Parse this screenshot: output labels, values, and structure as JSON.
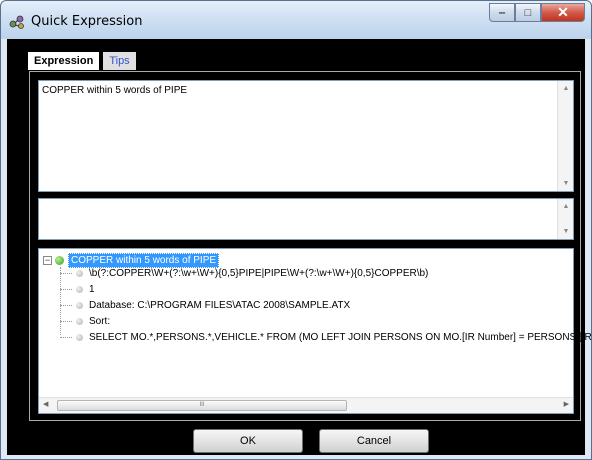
{
  "window": {
    "title": "Quick Expression",
    "minimize_glyph": "‒",
    "maximize_glyph": "□",
    "close_glyph": "✕"
  },
  "tabs": [
    {
      "label": "Expression",
      "active": true
    },
    {
      "label": "Tips",
      "active": false
    }
  ],
  "expression_text": "COPPER within 5 words of PIPE",
  "secondary_text": "",
  "tree": {
    "root": "COPPER within 5 words of PIPE",
    "children": [
      "\\b(?:COPPER\\W+(?:\\w+\\W+){0,5}PIPE|PIPE\\W+(?:\\w+\\W+){0,5}COPPER\\b)",
      "1",
      "Database: C:\\PROGRAM FILES\\ATAC 2008\\SAMPLE.ATX",
      "Sort:",
      "SELECT MO.*,PERSONS.*,VEHICLE.* FROM (MO LEFT JOIN PERSONS ON MO.[IR Number] = PERSONS.[IR N"
    ],
    "scroll_grip": "III"
  },
  "buttons": {
    "ok_label": "OK",
    "cancel_label": "Cancel"
  },
  "icons": {
    "app": "quick-expression-app-icon",
    "tree_root": "green-bullet-icon",
    "tree_leaf": "gray-bullet-icon"
  },
  "colors": {
    "selection": "#3399ff",
    "close_button": "#c2341e",
    "client_background": "#000000"
  }
}
